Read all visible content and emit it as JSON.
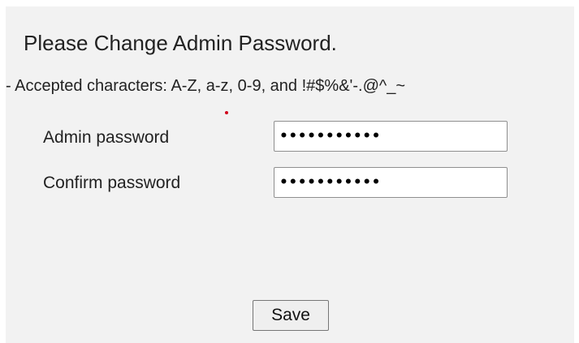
{
  "form": {
    "title": "Please Change Admin Password.",
    "accepted_chars_note": "- Accepted characters: A-Z, a-z, 0-9, and !#$%&'-.@^_~",
    "fields": [
      {
        "label": "Admin password",
        "value": "•••••••••••",
        "required": true
      },
      {
        "label": "Confirm password",
        "value": "•••••••••••",
        "required": false
      }
    ],
    "save_label": "Save",
    "required_marker_color": "#d0021b"
  }
}
